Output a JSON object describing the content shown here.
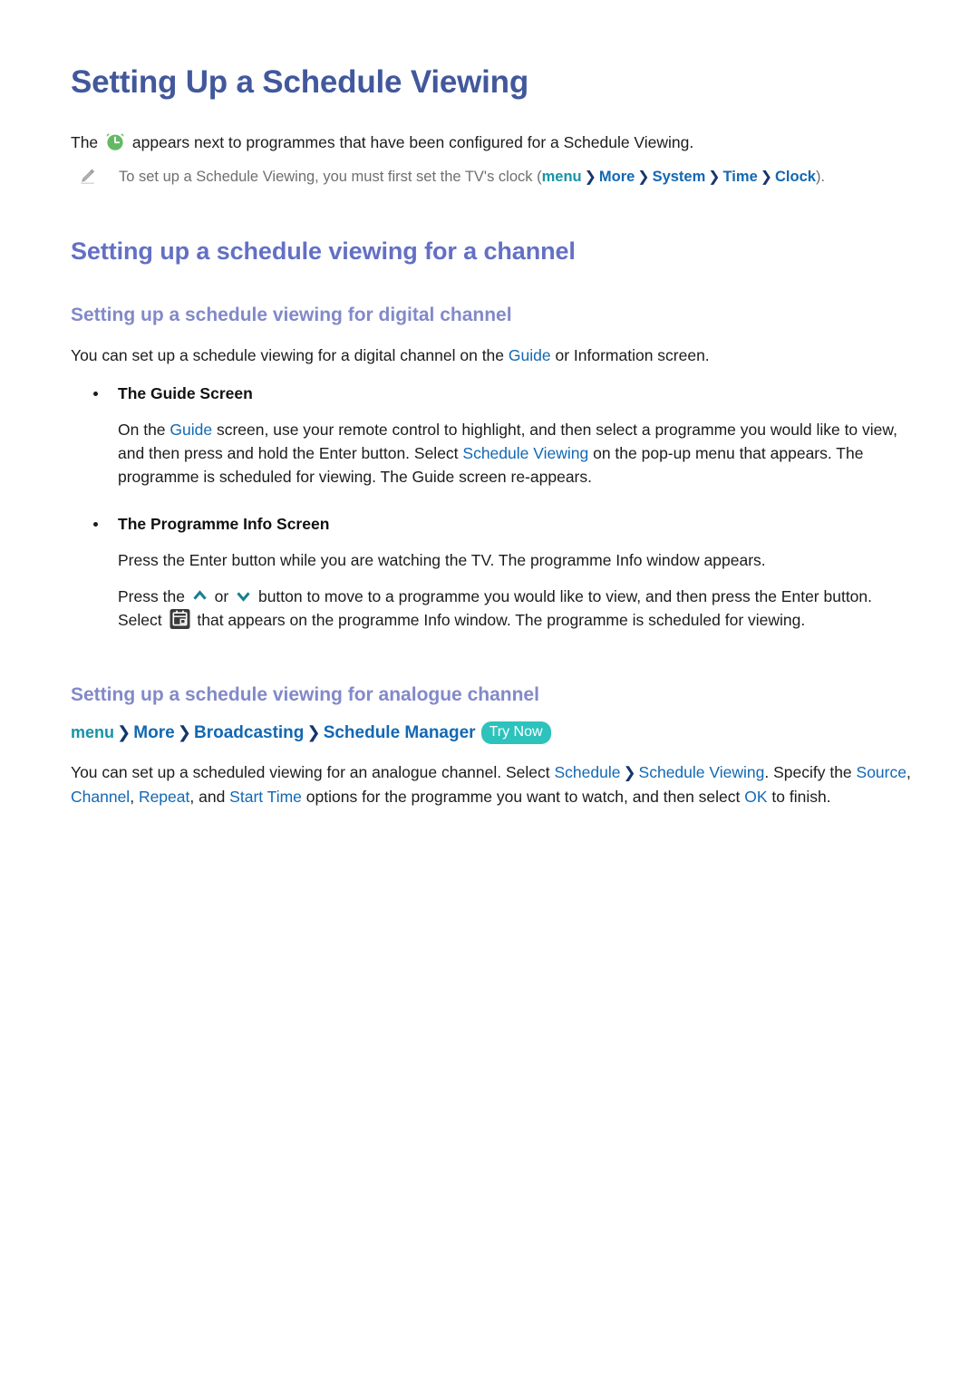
{
  "document": {
    "title": "Setting Up a Schedule Viewing",
    "intro": {
      "before_icon": "The ",
      "icon": "alarm-clock-icon",
      "after_icon": " appears next to programmes that have been configured for a Schedule Viewing."
    },
    "note": {
      "icon": "pencil-icon",
      "text_before": "To set up a Schedule Viewing, you must first set the TV's clock (",
      "path": [
        "menu",
        "More",
        "System",
        "Time",
        "Clock"
      ],
      "separator": "❯",
      "text_after": ")."
    },
    "section_channel": {
      "heading": "Setting up a schedule viewing for a channel",
      "digital": {
        "heading": "Setting up a schedule viewing for digital channel",
        "lead_p1": "You can set up a schedule viewing for a digital channel on the ",
        "lead_kw": "Guide",
        "lead_p2": " or Information screen.",
        "bullets": [
          {
            "label": "The Guide Screen",
            "paragraph_parts": [
              "On the ",
              "Guide",
              " screen, use your remote control to highlight, and then select a programme you would like to view, and then press and hold the Enter button. Select ",
              "Schedule Viewing",
              " on the pop-up menu that appears. The programme is scheduled for viewing. The Guide screen re-appears."
            ]
          },
          {
            "label": "The Programme Info Screen",
            "paragraph_line1": "Press the Enter button while you are watching the TV. The programme Info window appears.",
            "paragraph_line2_a": "Press the ",
            "up_icon": "chevron-up-icon",
            "paragraph_line2_b": " or ",
            "down_icon": "chevron-down-icon",
            "paragraph_line2_c": " button to move to a programme you would like to view, and then press the Enter button. Select ",
            "calendar_icon": "schedule-calendar-icon",
            "paragraph_line2_d": " that appears on the programme Info window. The programme is scheduled for viewing."
          }
        ]
      },
      "analogue": {
        "heading": "Setting up a schedule viewing for analogue channel",
        "path": [
          "menu",
          "More",
          "Broadcasting",
          "Schedule Manager"
        ],
        "separator": "❯",
        "badge": "Try Now",
        "paragraph_parts": [
          "You can set up a scheduled viewing for an analogue channel. Select ",
          "Schedule",
          " ❯ ",
          "Schedule Viewing",
          ". Specify the ",
          "Source",
          ", ",
          "Channel",
          ", ",
          "Repeat",
          ", and ",
          "Start Time",
          " options for the programme you want to watch, and then select ",
          "OK",
          " to finish."
        ]
      }
    }
  },
  "colors": {
    "title_blue": "#42589c",
    "h2_blue": "#6370c4",
    "h3_blue": "#8289c9",
    "keyword_blue": "#1268b3",
    "keyword_teal": "#1694a5",
    "badge_teal": "#2ec2bd",
    "clock_green": "#64b964",
    "chevron_teal": "#17808f",
    "note_gray": "#6f6f6f"
  }
}
